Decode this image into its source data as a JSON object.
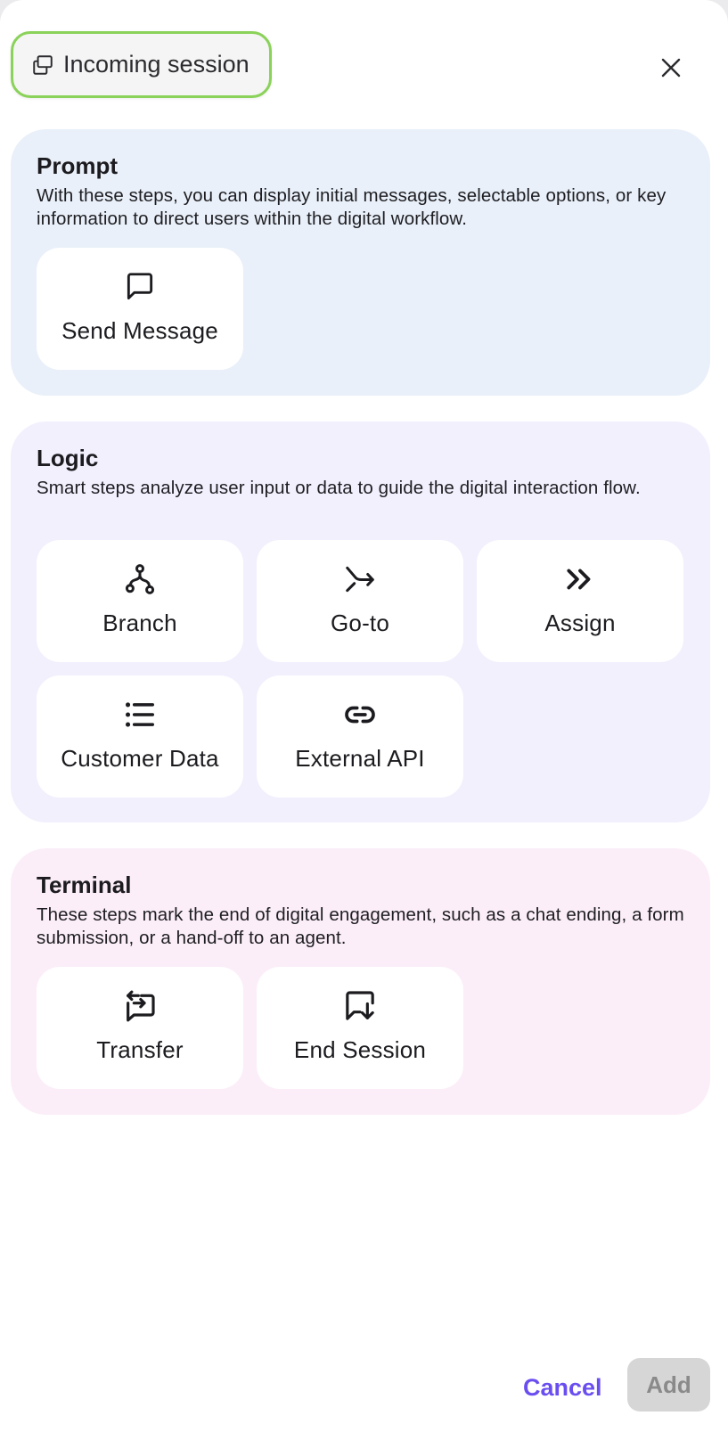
{
  "header": {
    "session_label": "Incoming session",
    "session_icon": "window-stack-icon",
    "close_icon": "close-icon"
  },
  "sections": {
    "prompt": {
      "title": "Prompt",
      "description": "With these steps, you can display initial messages, selectable options, or key information to direct users within the digital workflow.",
      "items": [
        {
          "label": "Send Message",
          "icon": "message-square-icon"
        }
      ]
    },
    "logic": {
      "title": "Logic",
      "description": "Smart steps analyze user input or data to guide the digital interaction flow.",
      "items": [
        {
          "label": "Branch",
          "icon": "branch-icon"
        },
        {
          "label": "Go-to",
          "icon": "goto-arrow-icon"
        },
        {
          "label": "Assign",
          "icon": "double-chevron-right-icon"
        },
        {
          "label": "Customer Data",
          "icon": "list-icon"
        },
        {
          "label": "External API",
          "icon": "link-icon"
        }
      ]
    },
    "terminal": {
      "title": "Terminal",
      "description": "These steps mark the end of digital engagement, such as a chat ending, a form submission, or a hand-off to an agent.",
      "items": [
        {
          "label": "Transfer",
          "icon": "transfer-chat-icon"
        },
        {
          "label": "End Session",
          "icon": "end-session-chat-icon"
        }
      ]
    }
  },
  "footer": {
    "cancel_label": "Cancel",
    "add_label": "Add"
  },
  "colors": {
    "accent": "#6b4ef0",
    "pill_border": "#8ad259",
    "prompt_bg": "#e9f0f9",
    "logic_bg": "#f2f0fd",
    "terminal_bg": "#fbeef8",
    "add_disabled_bg": "#d6d6d6"
  }
}
